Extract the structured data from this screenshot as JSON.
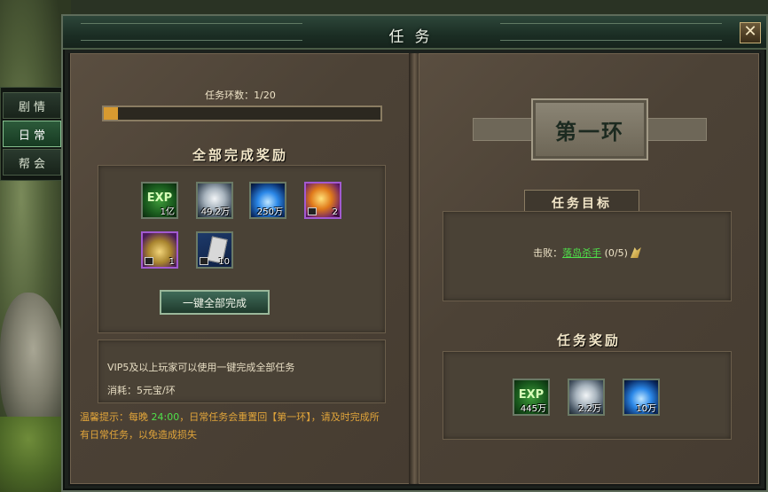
{
  "window": {
    "title": "任务"
  },
  "side_tabs": [
    {
      "label": "剧  情",
      "active": false
    },
    {
      "label": "日  常",
      "active": true
    },
    {
      "label": "帮  会",
      "active": false
    }
  ],
  "left_page": {
    "progress_label": "任务环数：1/20",
    "progress": {
      "current": 1,
      "total": 20
    },
    "all_complete_reward_title": "全部完成奖励",
    "reward_items": [
      {
        "icon": "exp-icon",
        "qty": "1亿"
      },
      {
        "icon": "silver-coin-icon",
        "qty": "49.2万"
      },
      {
        "icon": "blue-flame-icon",
        "qty": "250万"
      },
      {
        "icon": "orange-orb-icon",
        "qty": "2",
        "bound": true
      },
      {
        "icon": "gold-chest-icon",
        "qty": "1",
        "bound": true
      },
      {
        "icon": "scroll-book-icon",
        "qty": "10",
        "bound": true
      }
    ],
    "one_key_button": "一键全部完成",
    "vip_note": "VIP5及以上玩家可以使用一键完成全部任务",
    "cost_label": "消耗：",
    "cost_value": "5元宝/环",
    "tip_prefix": "温馨提示：每晚 ",
    "tip_time": "24:00",
    "tip_suffix": "，日常任务会重置回【第一环】，请及时完成所有日常任务，以免造成损失"
  },
  "right_page": {
    "ring_title": "第一环",
    "goal_title": "任务目标",
    "goal_label": "击败：",
    "goal_target": "落岛杀手",
    "goal_count": "(0/5)",
    "reward_title": "任务奖励",
    "reward_items": [
      {
        "icon": "exp-icon",
        "qty": "445万"
      },
      {
        "icon": "silver-coin-icon",
        "qty": "2.2万"
      },
      {
        "icon": "blue-flame-icon",
        "qty": "10万"
      }
    ]
  },
  "colors": {
    "progress_fill": "#d89a30",
    "highlight_green": "#4fe04a",
    "tip_orange": "#e0a43a"
  }
}
